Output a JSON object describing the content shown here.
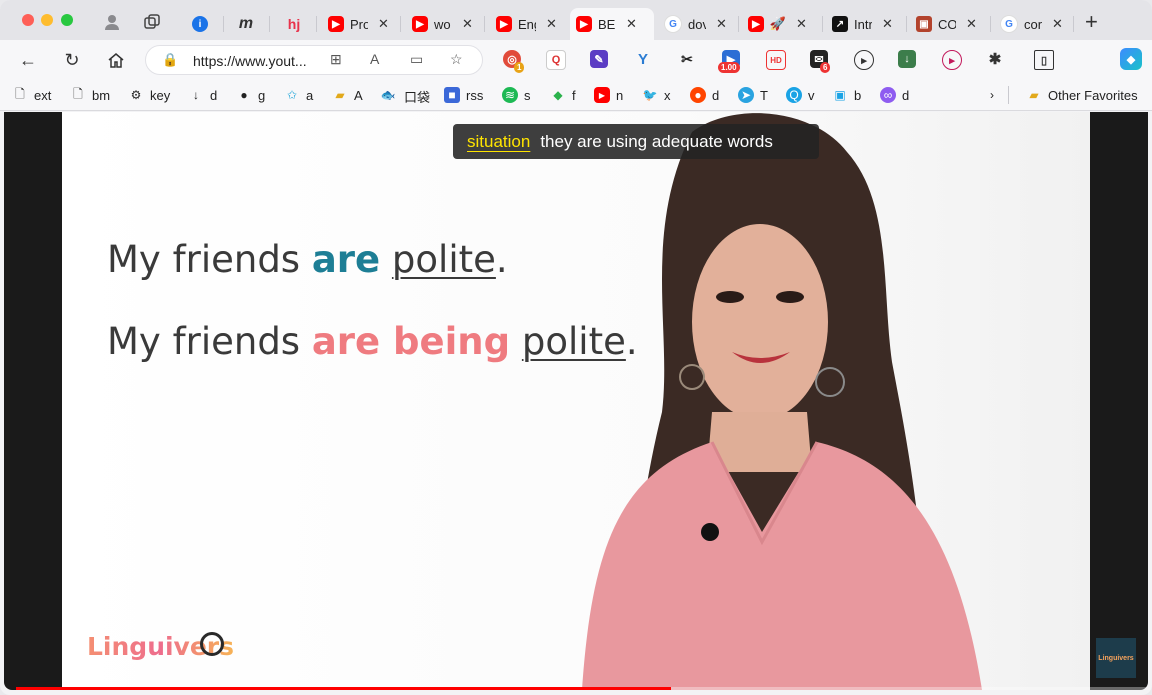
{
  "tabs": [
    {
      "label": "",
      "favicon": "info",
      "active": false
    },
    {
      "label": "",
      "favicon": "m",
      "active": false
    },
    {
      "label": "",
      "favicon": "hj",
      "active": false
    },
    {
      "label": "Pro",
      "favicon": "youtube",
      "active": false
    },
    {
      "label": "wo",
      "favicon": "youtube",
      "active": false
    },
    {
      "label": "Eng",
      "favicon": "youtube",
      "active": false
    },
    {
      "label": "BE",
      "favicon": "youtube",
      "active": true
    },
    {
      "label": "dov",
      "favicon": "google",
      "active": false
    },
    {
      "label": "",
      "favicon": "youtube",
      "active": false
    },
    {
      "label": "Intr",
      "favicon": "arrow",
      "active": false
    },
    {
      "label": "CO",
      "favicon": "crest",
      "active": false
    },
    {
      "label": "cor",
      "favicon": "google",
      "active": false
    }
  ],
  "address_bar": {
    "url": "https://www.yout..."
  },
  "extension_badges": {
    "ext1": "1",
    "speed": "1.00",
    "ext_hd": "HD",
    "ext_mail": "6"
  },
  "bookmarks": [
    {
      "label": "ext",
      "icon": "page-icon"
    },
    {
      "label": "bm",
      "icon": "page-icon"
    },
    {
      "label": "key",
      "icon": "puzzle-icon"
    },
    {
      "label": "d",
      "icon": "download-icon"
    },
    {
      "label": "g",
      "icon": "github-icon"
    },
    {
      "label": "a",
      "icon": "star-icon"
    },
    {
      "label": "A",
      "icon": "folder-icon"
    },
    {
      "label": "",
      "icon": "fish-icon"
    },
    {
      "label": "口袋",
      "icon": "pocket-text"
    },
    {
      "label": "rss",
      "icon": "rss-icon"
    },
    {
      "label": "s",
      "icon": "spotify-icon"
    },
    {
      "label": "f",
      "icon": "feedly-icon"
    },
    {
      "label": "n",
      "icon": "youtube-icon"
    },
    {
      "label": "x",
      "icon": "twitter-icon"
    },
    {
      "label": "d",
      "icon": "reddit-icon"
    },
    {
      "label": "T",
      "icon": "telegram-icon"
    },
    {
      "label": "v",
      "icon": "search-icon"
    },
    {
      "label": "b",
      "icon": "bilibili-icon"
    },
    {
      "label": "d",
      "icon": "discord-icon"
    }
  ],
  "bookmark_badge": "175",
  "other_favorites": "Other Favorites",
  "video": {
    "caption_highlight": "situation",
    "caption_rest": "they are using adequate words",
    "sentence1": {
      "lead": "My friends ",
      "verb": "are",
      "space": " ",
      "adj": "polite",
      "end": "."
    },
    "sentence2": {
      "lead": "My friends ",
      "verb": "are being",
      "space": " ",
      "adj": "polite",
      "end": "."
    },
    "logo": "Linguivers",
    "thumb_logo": "Linguivers",
    "progress": 0.58
  },
  "colors": {
    "teal": "#1d7e95",
    "pink": "#ef7b80",
    "caption_highlight": "#ffe400",
    "progress": "#ff0000"
  }
}
